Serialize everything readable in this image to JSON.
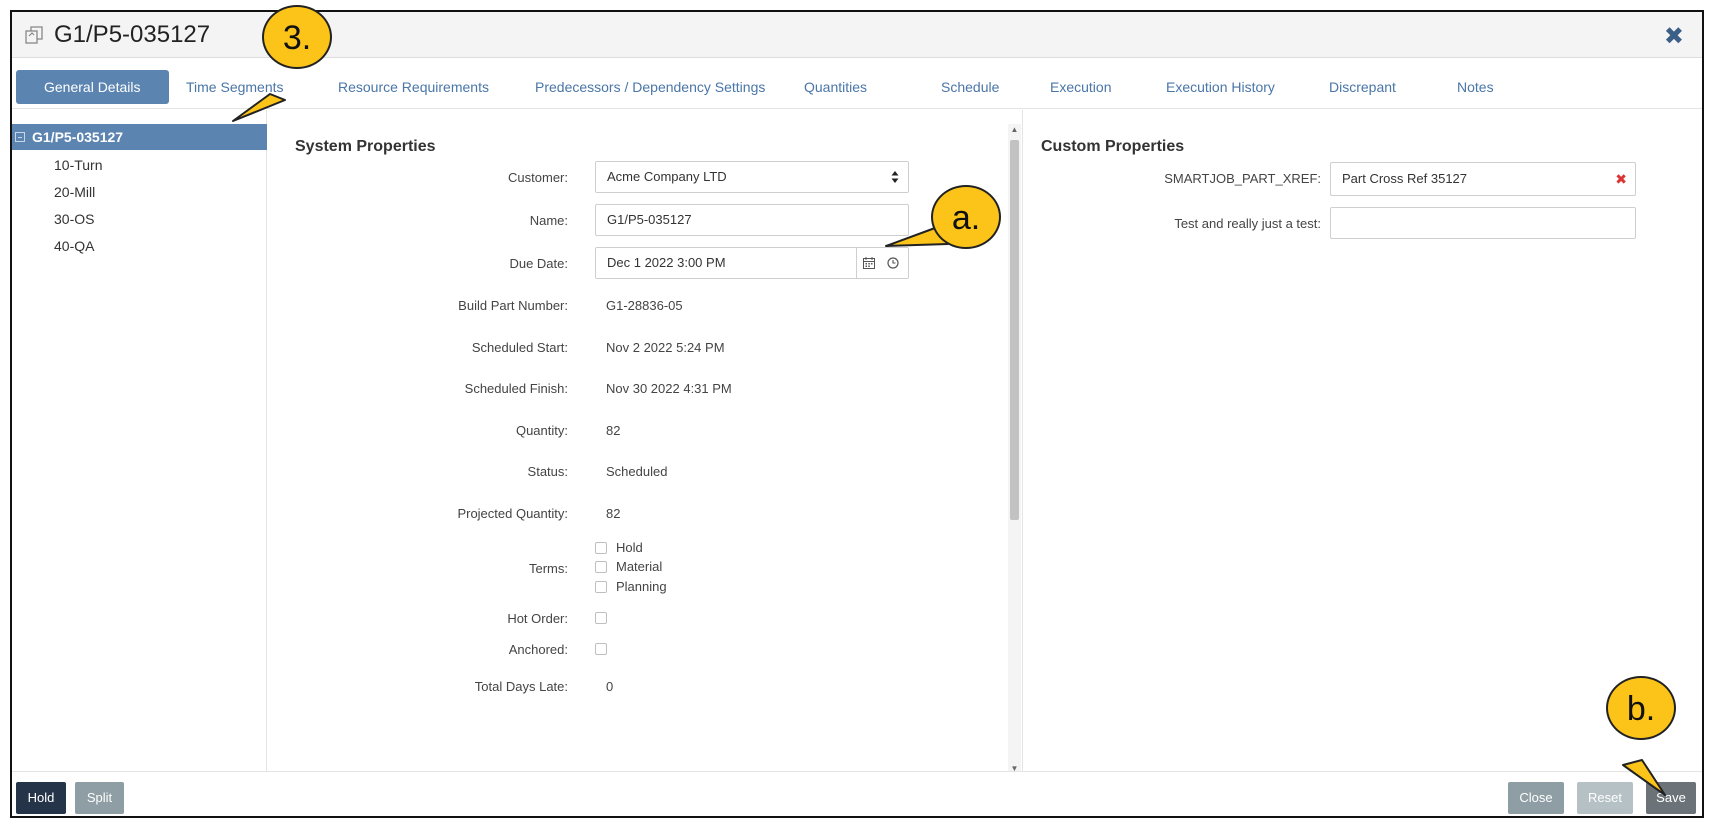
{
  "window": {
    "title": "G1/P5-035127"
  },
  "tabs": [
    {
      "label": "General Details",
      "active": true
    },
    {
      "label": "Time Segments"
    },
    {
      "label": "Resource Requirements"
    },
    {
      "label": "Predecessors / Dependency Settings"
    },
    {
      "label": "Quantities"
    },
    {
      "label": "Schedule"
    },
    {
      "label": "Execution"
    },
    {
      "label": "Execution History"
    },
    {
      "label": "Discrepant"
    },
    {
      "label": "Notes"
    }
  ],
  "tree": {
    "root": "G1/P5-035127",
    "children": [
      "10-Turn",
      "20-Mill",
      "30-OS",
      "40-QA"
    ]
  },
  "system": {
    "title": "System Properties",
    "customer": {
      "label": "Customer:",
      "value": "Acme Company LTD"
    },
    "name": {
      "label": "Name:",
      "value": "G1/P5-035127"
    },
    "due_date": {
      "label": "Due Date:",
      "value": "Dec 1 2022 3:00 PM"
    },
    "build_part_number": {
      "label": "Build Part Number:",
      "value": "G1-28836-05"
    },
    "scheduled_start": {
      "label": "Scheduled Start:",
      "value": "Nov 2 2022 5:24 PM"
    },
    "scheduled_finish": {
      "label": "Scheduled Finish:",
      "value": "Nov 30 2022 4:31 PM"
    },
    "quantity": {
      "label": "Quantity:",
      "value": "82"
    },
    "status": {
      "label": "Status:",
      "value": "Scheduled"
    },
    "projected_quantity": {
      "label": "Projected Quantity:",
      "value": "82"
    },
    "terms": {
      "label": "Terms:",
      "options": [
        "Hold",
        "Material",
        "Planning"
      ]
    },
    "hot_order": {
      "label": "Hot Order:"
    },
    "anchored": {
      "label": "Anchored:"
    },
    "total_days_late": {
      "label": "Total Days Late:",
      "value": "0"
    }
  },
  "custom": {
    "title": "Custom Properties",
    "part_xref": {
      "label": "SMARTJOB_PART_XREF:",
      "value": "Part Cross Ref 35127"
    },
    "test": {
      "label": "Test and really just a test:",
      "value": ""
    }
  },
  "footer": {
    "hold": "Hold",
    "split": "Split",
    "close": "Close",
    "reset": "Reset",
    "save": "Save"
  },
  "callouts": {
    "a": "a.",
    "b": "b.",
    "three": "3."
  },
  "colors": {
    "accent": "#5b84b1",
    "tab_text": "#4a76a8",
    "hold_button": "#263449",
    "split_button": "#8e9ea4",
    "close_button": "#8e9ea4",
    "reset_button": "#b6c1c5",
    "save_button": "#6c7378",
    "callout": "#fcc419",
    "clear_x": "#dd3333"
  },
  "icons": {
    "title": "copy-icon",
    "close": "close-icon",
    "calendar": "calendar-icon",
    "clock": "clock-icon",
    "select": "select-arrows-icon",
    "tree_toggle": "minus-square-icon"
  }
}
